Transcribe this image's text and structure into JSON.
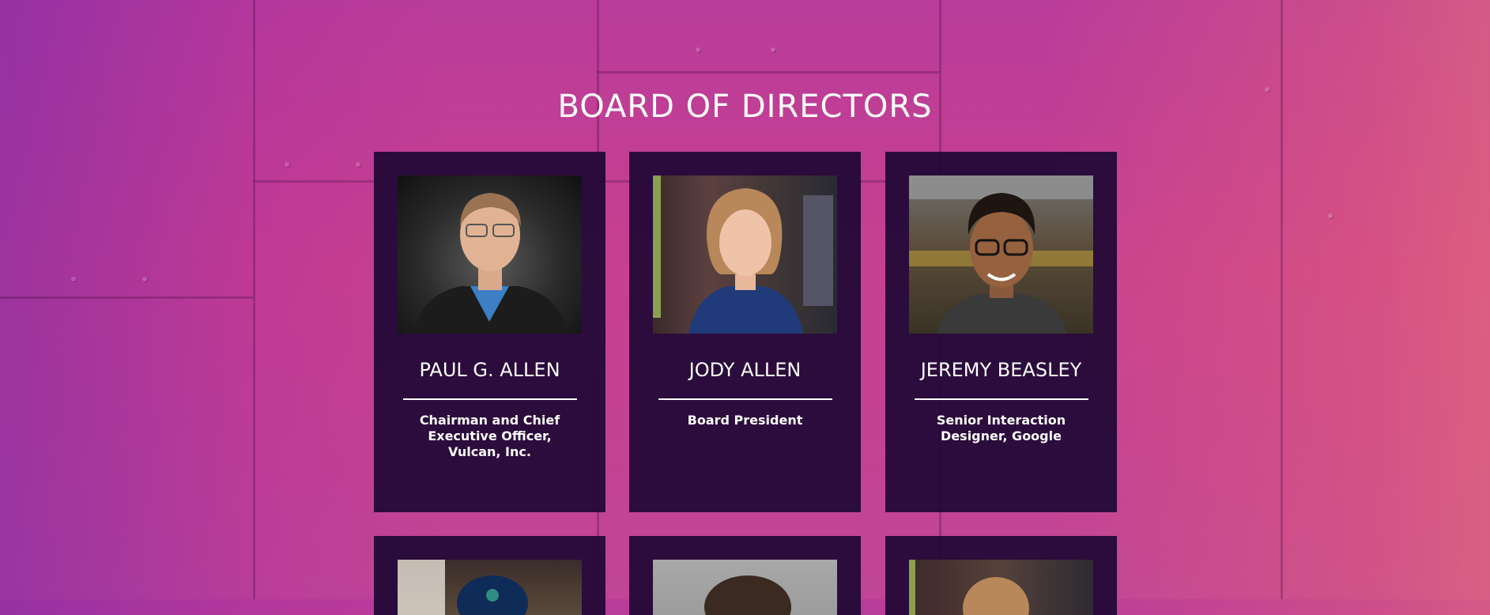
{
  "section": {
    "title": "BOARD OF DIRECTORS"
  },
  "directors": [
    {
      "name": "PAUL G. ALLEN",
      "role": "Chairman and Chief Executive Officer, Vulcan, Inc."
    },
    {
      "name": "JODY ALLEN",
      "role": "Board President"
    },
    {
      "name": "JEREMY BEASLEY",
      "role": "Senior Interaction Designer, Google"
    }
  ],
  "colors": {
    "card_background": "#210836",
    "text": "#ffffff",
    "page_background": "#c8408f"
  }
}
